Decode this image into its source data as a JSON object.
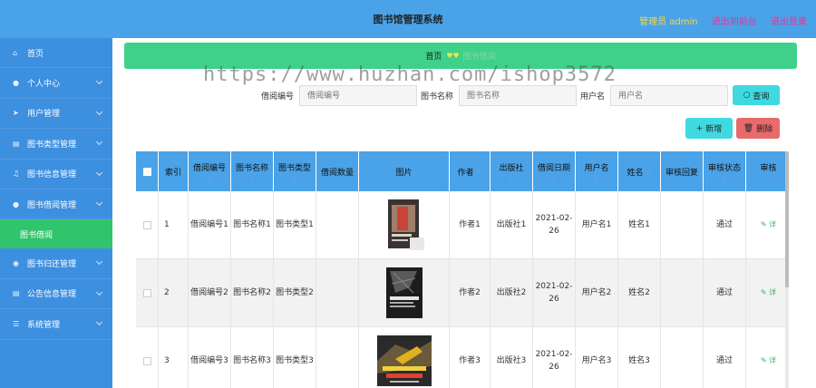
{
  "header": {
    "title": "图书馆管理系统",
    "user": "管理员 admin",
    "back": "退出到前台",
    "logout": "退出登录"
  },
  "sidebar": {
    "items": [
      {
        "label": "首页",
        "icon": "home-icon"
      },
      {
        "label": "个人中心",
        "icon": "user-icon"
      },
      {
        "label": "用户管理",
        "icon": "send-icon"
      },
      {
        "label": "图书类型管理",
        "icon": "list-icon"
      },
      {
        "label": "图书信息管理",
        "icon": "bell-icon"
      },
      {
        "label": "图书借阅管理",
        "icon": "user-icon"
      },
      {
        "label": "图书借阅",
        "icon": ""
      },
      {
        "label": "图书归还管理",
        "icon": "pin-icon"
      },
      {
        "label": "公告信息管理",
        "icon": "list-icon"
      },
      {
        "label": "系统管理",
        "icon": "menu-icon"
      }
    ]
  },
  "breadcrumb": {
    "home": "首页",
    "hearts": "♥♥",
    "current": "图书借阅"
  },
  "watermark": "https://www.huzhan.com/ishop3572",
  "search": {
    "fields": [
      {
        "label": "借阅编号",
        "placeholder": "借阅编号"
      },
      {
        "label": "图书名称",
        "placeholder": "图书名称"
      },
      {
        "label": "用户名",
        "placeholder": "用户名"
      }
    ],
    "button": "查询"
  },
  "actions": {
    "add": "新增",
    "delete": "删除"
  },
  "table": {
    "columns": [
      "索引",
      "借阅编号",
      "图书名称",
      "图书类型",
      "借阅数量",
      "图片",
      "作者",
      "出版社",
      "借阅日期",
      "用户名",
      "姓名",
      "审核回复",
      "审核状态",
      "审核"
    ],
    "rows": [
      {
        "index": "1",
        "code": "借阅编号1",
        "name": "图书名称1",
        "type": "图书类型1",
        "qty": "",
        "author": "作者1",
        "publisher": "出版社1",
        "date": "2021-02-26",
        "username": "用户名1",
        "realname": "姓名1",
        "reply": "",
        "status": "通过",
        "op": "✎ 详"
      },
      {
        "index": "2",
        "code": "借阅编号2",
        "name": "图书名称2",
        "type": "图书类型2",
        "qty": "",
        "author": "作者2",
        "publisher": "出版社2",
        "date": "2021-02-26",
        "username": "用户名2",
        "realname": "姓名2",
        "reply": "",
        "status": "通过",
        "op": "✎ 详"
      },
      {
        "index": "3",
        "code": "借阅编号3",
        "name": "图书名称3",
        "type": "图书类型3",
        "qty": "",
        "author": "作者3",
        "publisher": "出版社3",
        "date": "2021-02-26",
        "username": "用户名3",
        "realname": "姓名3",
        "reply": "",
        "status": "通过",
        "op": "✎ 详"
      }
    ]
  },
  "colors": {
    "header": "#4aa3e8",
    "sidebar": "#3d8fe0",
    "active": "#30c46c",
    "breadcrumb": "#3fd08a",
    "delete": "#e86a6a",
    "primary": "#3fd9e0"
  }
}
